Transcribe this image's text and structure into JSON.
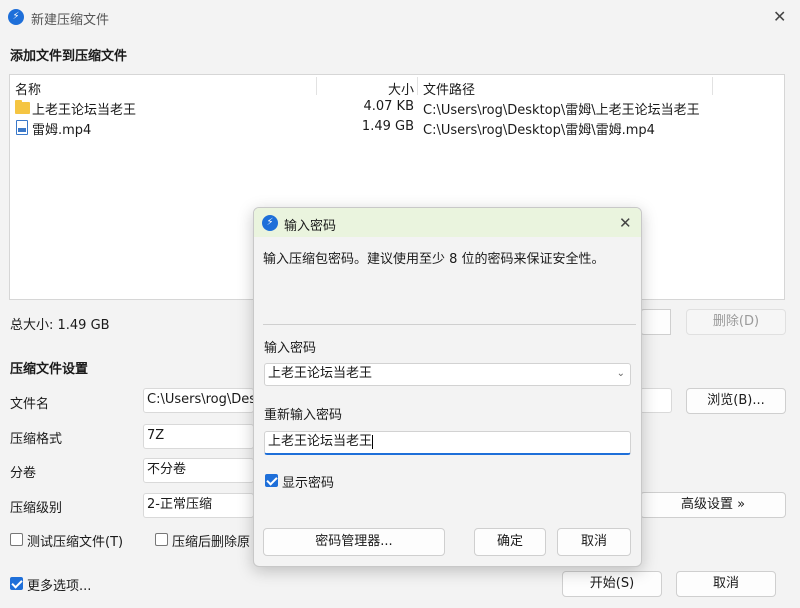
{
  "window": {
    "title": "新建压缩文件",
    "app_icon": "app-logo-icon"
  },
  "add_section": {
    "heading": "添加文件到压缩文件"
  },
  "file_table": {
    "columns": {
      "name": "名称",
      "size": "大小",
      "path": "文件路径"
    },
    "rows": [
      {
        "icon": "folder-icon",
        "name": "上老王论坛当老王",
        "size": "4.07 KB",
        "path": "C:\\Users\\rog\\Desktop\\雷姆\\上老王论坛当老王"
      },
      {
        "icon": "video-file-icon",
        "name": "雷姆.mp4",
        "size": "1.49 GB",
        "path": "C:\\Users\\rog\\Desktop\\雷姆\\雷姆.mp4"
      }
    ]
  },
  "total": {
    "label": "总大小: 1.49 GB"
  },
  "buttons": {
    "delete": "删除(D)",
    "browse": "浏览(B)...",
    "advanced": "高级设置 »",
    "start": "开始(S)",
    "cancel": "取消"
  },
  "settings": {
    "heading": "压缩文件设置",
    "filename_label": "文件名",
    "filename_value": "C:\\Users\\rog\\Des",
    "format_label": "压缩格式",
    "format_value": "7Z",
    "split_label": "分卷",
    "split_value": "不分卷",
    "level_label": "压缩级别",
    "level_value": "2-正常压缩",
    "test_label": "测试压缩文件(T)",
    "delete_after_label": "压缩后删除原"
  },
  "more_options": {
    "label": "更多选项...",
    "checked": true
  },
  "password_dialog": {
    "title": "输入密码",
    "description": "输入压缩包密码。建议使用至少 8 位的密码来保证安全性。",
    "password_label": "输入密码",
    "password_value": "上老王论坛当老王",
    "confirm_label": "重新输入密码",
    "confirm_value": "上老王论坛当老王",
    "show_password_label": "显示密码",
    "show_password_checked": true,
    "manager_button": "密码管理器...",
    "ok_button": "确定",
    "cancel_button": "取消"
  },
  "colors": {
    "accent": "#1e6fd9",
    "dialog_title_bg": "#eaf4de",
    "folder": "#f5c542"
  }
}
